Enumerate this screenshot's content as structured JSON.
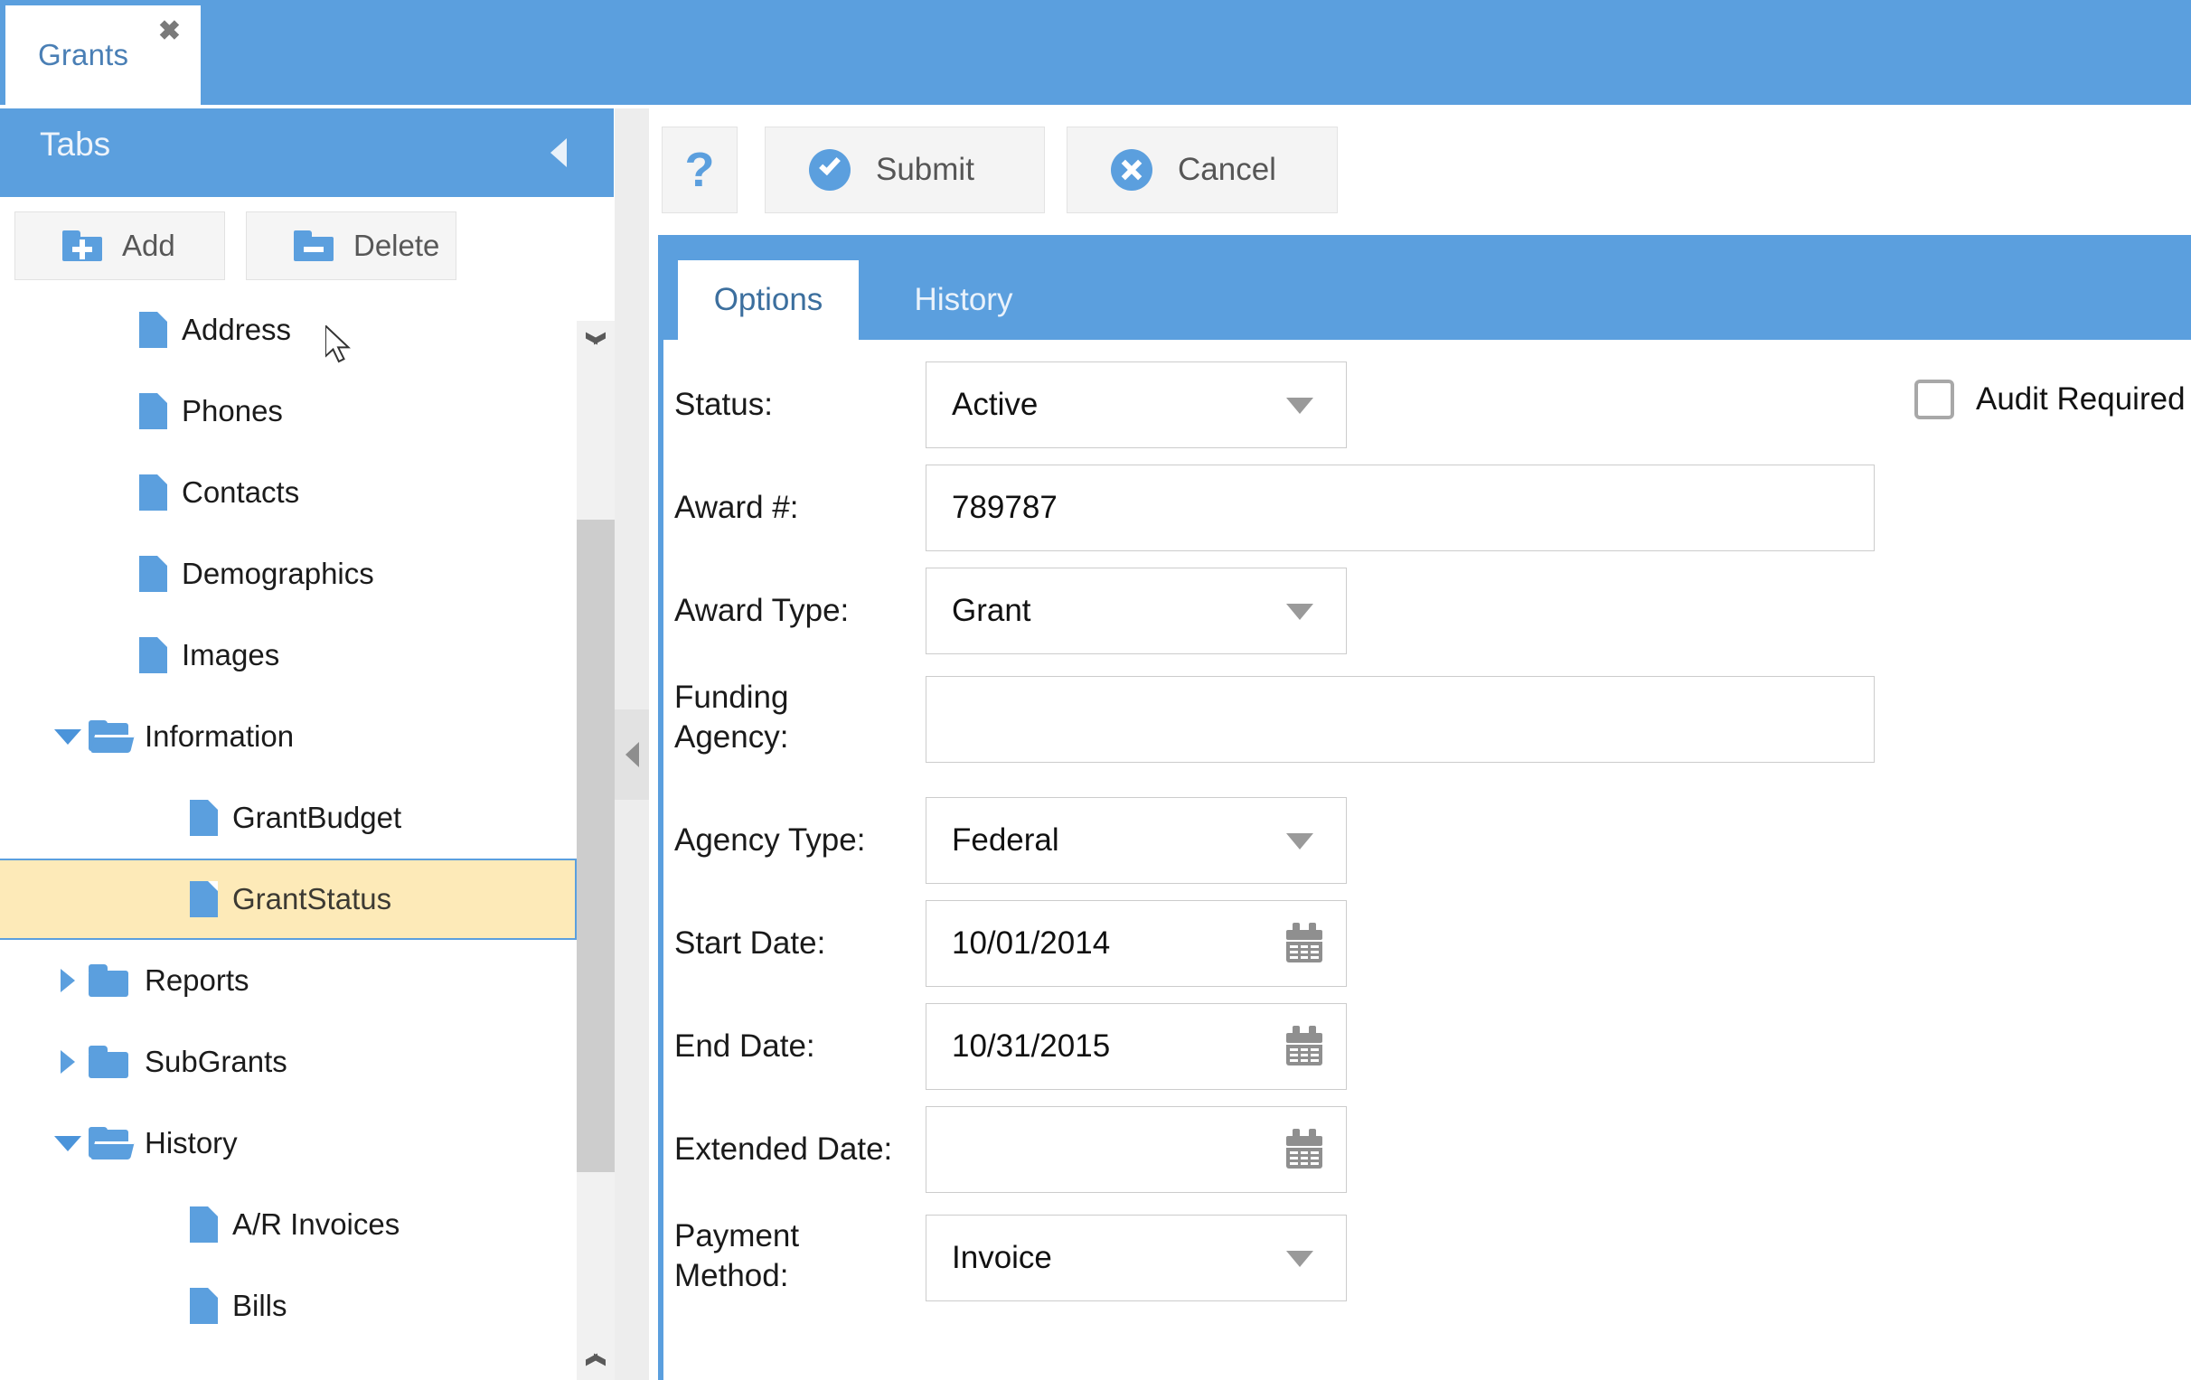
{
  "window": {
    "tab_label": "Grants",
    "close_icon": "close-icon"
  },
  "sidebar": {
    "header_title": "Tabs",
    "collapse_icon": "collapse-left-icon",
    "toolbar": {
      "add_label": "Add",
      "delete_label": "Delete"
    },
    "tree": [
      {
        "label": "Address",
        "type": "file",
        "indent": 1,
        "twisty": "none",
        "selected": false
      },
      {
        "label": "Phones",
        "type": "file",
        "indent": 1,
        "twisty": "none",
        "selected": false
      },
      {
        "label": "Contacts",
        "type": "file",
        "indent": 1,
        "twisty": "none",
        "selected": false
      },
      {
        "label": "Demographics",
        "type": "file",
        "indent": 1,
        "twisty": "none",
        "selected": false
      },
      {
        "label": "Images",
        "type": "file",
        "indent": 1,
        "twisty": "none",
        "selected": false
      },
      {
        "label": "Information",
        "type": "folder-open",
        "indent": 0,
        "twisty": "expanded",
        "selected": false
      },
      {
        "label": "GrantBudget",
        "type": "file",
        "indent": 2,
        "twisty": "none",
        "selected": false
      },
      {
        "label": "GrantStatus",
        "type": "file",
        "indent": 2,
        "twisty": "none",
        "selected": true
      },
      {
        "label": "Reports",
        "type": "folder-closed",
        "indent": 0,
        "twisty": "collapsed",
        "selected": false
      },
      {
        "label": "SubGrants",
        "type": "folder-closed",
        "indent": 0,
        "twisty": "collapsed",
        "selected": false
      },
      {
        "label": "History",
        "type": "folder-open",
        "indent": 0,
        "twisty": "expanded",
        "selected": false
      },
      {
        "label": "A/R Invoices",
        "type": "file",
        "indent": 2,
        "twisty": "none",
        "selected": false
      },
      {
        "label": "Bills",
        "type": "file",
        "indent": 2,
        "twisty": "none",
        "selected": false
      }
    ]
  },
  "main": {
    "toolbar": {
      "help_label": "?",
      "submit_label": "Submit",
      "cancel_label": "Cancel"
    },
    "tabs": [
      {
        "label": "Options",
        "active": true
      },
      {
        "label": "History",
        "active": false
      }
    ],
    "form": {
      "status": {
        "label": "Status:",
        "value": "Active"
      },
      "award_number": {
        "label": "Award #:",
        "value": "789787"
      },
      "award_type": {
        "label": "Award Type:",
        "value": "Grant"
      },
      "funding_agency": {
        "label_line1": "Funding",
        "label_line2": "Agency:",
        "value": ""
      },
      "agency_type": {
        "label": "Agency Type:",
        "value": "Federal"
      },
      "start_date": {
        "label": "Start Date:",
        "value": "10/01/2014"
      },
      "end_date": {
        "label": "End Date:",
        "value": "10/31/2015"
      },
      "extended_date": {
        "label": "Extended Date:",
        "value": ""
      },
      "payment_method": {
        "label_line1": "Payment",
        "label_line2": "Method:",
        "value": "Invoice"
      },
      "audit_required": {
        "label": "Audit Required",
        "checked": false
      }
    }
  },
  "colors": {
    "accent_blue": "#5b9fde",
    "selection_yellow": "#fdeab8",
    "toolbar_gray": "#f4f4f4",
    "border_gray": "#cccccc"
  }
}
